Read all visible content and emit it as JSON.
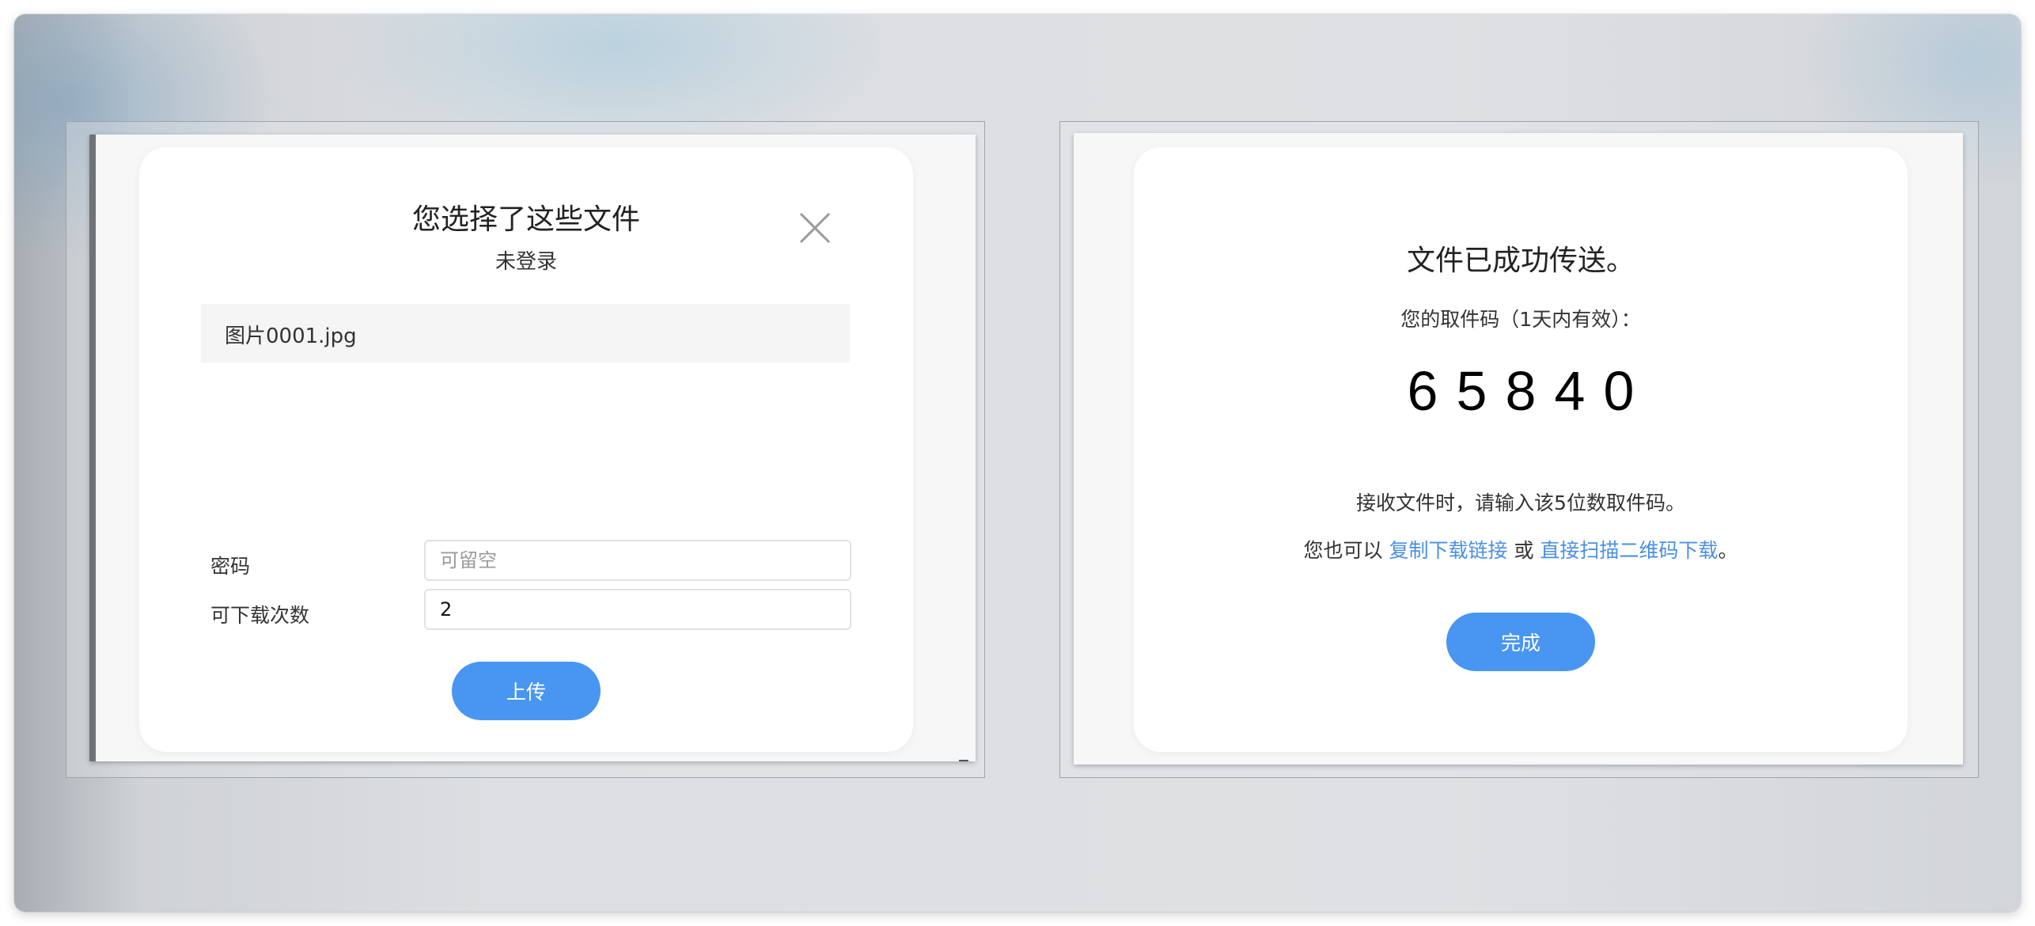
{
  "upload_dialog": {
    "title": "您选择了这些文件",
    "login_status": "未登录",
    "close_icon": "close-icon",
    "files": [
      {
        "name": "图片0001.jpg"
      }
    ],
    "password": {
      "label": "密码",
      "value": "",
      "placeholder": "可留空"
    },
    "download_limit": {
      "label": "可下载次数",
      "value": "2"
    },
    "upload_button": "上传"
  },
  "success_dialog": {
    "title": "文件已成功传送。",
    "code_label": "您的取件码（1天内有效）：",
    "code_digits": [
      "6",
      "5",
      "8",
      "4",
      "0"
    ],
    "hint": "接收文件时，请输入该5位数取件码。",
    "alt_prefix": "您也可以 ",
    "copy_link": "复制下载链接",
    "or": " 或 ",
    "scan_link": "直接扫描二维码下载",
    "alt_suffix": "。",
    "done_button": "完成"
  },
  "colors": {
    "accent": "#4896f2",
    "link": "#4a90e2"
  }
}
